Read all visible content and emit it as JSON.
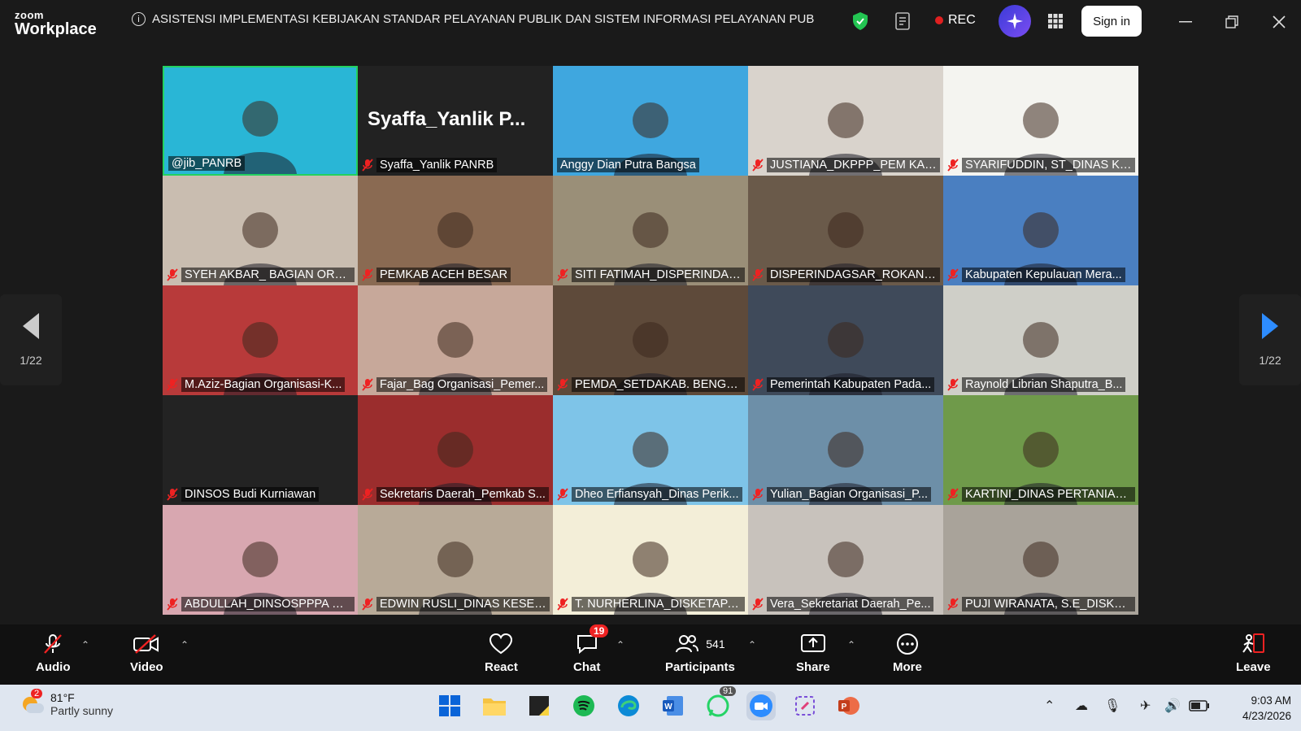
{
  "app": {
    "logo_line1": "zoom",
    "logo_line2": "Workplace"
  },
  "meeting_title": "ASISTENSI IMPLEMENTASI KEBIJAKAN STANDAR PELAYANAN PUBLIK DAN SISTEM INFORMASI PELAYANAN PUBLIK NASIO",
  "rec_label": "REC",
  "signin_label": "Sign in",
  "page_indicator_left": "1/22",
  "page_indicator_right": "1/22",
  "big_name_text": "Syaffa_Yanlik  P...",
  "participants": [
    {
      "name": "@jib_PANRB",
      "muted": false,
      "active": true,
      "bg": "#29b6d6"
    },
    {
      "name": "Syaffa_Yanlik PANRB",
      "muted": true,
      "bg": "#222222"
    },
    {
      "name": "Anggy Dian Putra Bangsa",
      "muted": false,
      "bg": "#3fa7df"
    },
    {
      "name": "JUSTIANA_DKPPP_PEM KAP ...",
      "muted": true,
      "bg": "#d9d3cc"
    },
    {
      "name": "SYARIFUDDIN, ST_DINAS KE...",
      "muted": true,
      "bg": "#f4f4f0"
    },
    {
      "name": "SYEH AKBAR_ BAGIAN ORG...",
      "muted": true,
      "bg": "#c9bdb0"
    },
    {
      "name": "PEMKAB ACEH BESAR",
      "muted": true,
      "bg": "#8a6a52"
    },
    {
      "name": "SITI FATIMAH_DISPERINDAG...",
      "muted": true,
      "bg": "#9a8f78"
    },
    {
      "name": "DISPERINDAGSAR_ROKAN H...",
      "muted": true,
      "bg": "#6a5a4a"
    },
    {
      "name": "Kabupaten Kepulauan Mera...",
      "muted": true,
      "bg": "#4a7fc1"
    },
    {
      "name": "M.Aziz-Bagian Organisasi-K...",
      "muted": true,
      "bg": "#b83a3a"
    },
    {
      "name": "Fajar_Bag Organisasi_Pemer...",
      "muted": true,
      "bg": "#c7a89a"
    },
    {
      "name": "PEMDA_SETDAKAB. BENGK...",
      "muted": true,
      "bg": "#5e4a3a"
    },
    {
      "name": "Pemerintah Kabupaten Pada...",
      "muted": true,
      "bg": "#3f4a5a"
    },
    {
      "name": "Raynold Librian Shaputra_B...",
      "muted": true,
      "bg": "#cfcfc8"
    },
    {
      "name": "DINSOS Budi Kurniawan",
      "muted": true,
      "bg": "#232323"
    },
    {
      "name": "Sekretaris Daerah_Pemkab S...",
      "muted": true,
      "bg": "#9b2d2d"
    },
    {
      "name": "Dheo Erfiansyah_Dinas Perik...",
      "muted": true,
      "bg": "#7ec4e8"
    },
    {
      "name": "Yulian_Bagian Organisasi_P...",
      "muted": true,
      "bg": "#6d8fa8"
    },
    {
      "name": "KARTINI_DINAS PERTANIAN ...",
      "muted": true,
      "bg": "#6f9a4a"
    },
    {
      "name": "ABDULLAH_DINSOSPPPA KA...",
      "muted": true,
      "bg": "#d8a7b0"
    },
    {
      "name": "EDWIN RUSLI_DINAS KESEH...",
      "muted": true,
      "bg": "#b8aa98"
    },
    {
      "name": "T. NURHERLINA_DISKETAPA...",
      "muted": true,
      "bg": "#f3eed8"
    },
    {
      "name": "Vera_Sekretariat Daerah_Pe...",
      "muted": true,
      "bg": "#c8c2bc"
    },
    {
      "name": "PUJI WIRANATA, S.E_DISKOP...",
      "muted": true,
      "bg": "#a9a39a"
    }
  ],
  "toolbar": {
    "audio": "Audio",
    "video": "Video",
    "react": "React",
    "chat": "Chat",
    "chat_badge": "19",
    "participants": "Participants",
    "participants_count": "541",
    "share": "Share",
    "more": "More",
    "leave": "Leave"
  },
  "taskbar": {
    "weather_temp": "81°F",
    "weather_desc": "Partly sunny",
    "weather_badge": "2",
    "whatsapp_badge": "91",
    "time": "9:03 AM",
    "date": "4/23/2026"
  }
}
